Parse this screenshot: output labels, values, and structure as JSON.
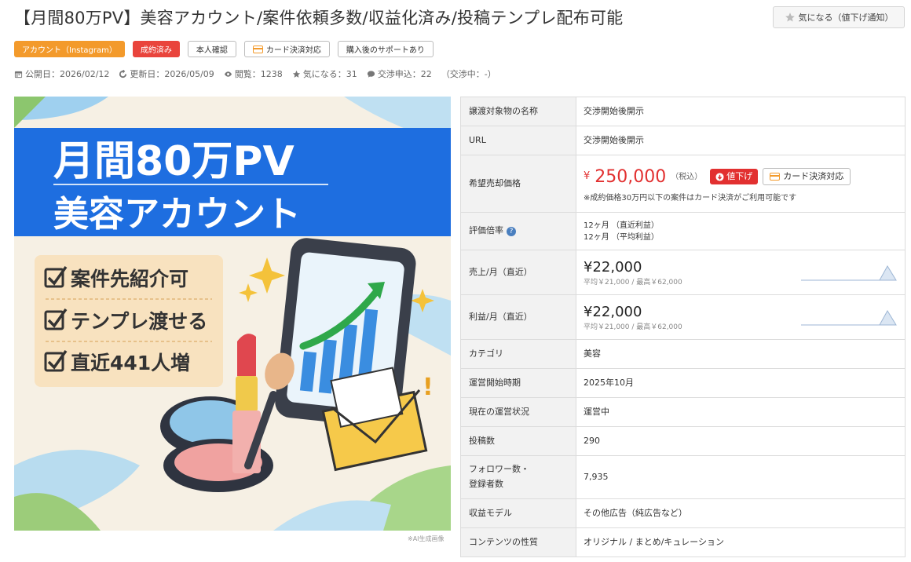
{
  "header": {
    "title": "【月間80万PV】美容アカウント/案件依頼多数/収益化済み/投稿テンプレ配布可能",
    "favorite_button": "気になる（値下げ通知）"
  },
  "tags": [
    {
      "label": "アカウント（Instagram）",
      "style": "orange"
    },
    {
      "label": "成約済み",
      "style": "red"
    },
    {
      "label": "本人確認",
      "style": "outline"
    },
    {
      "label": "カード決済対応",
      "style": "outline-card"
    },
    {
      "label": "購入後のサポートあり",
      "style": "outline"
    }
  ],
  "meta": {
    "published": "公開日：2026/02/12",
    "updated": "更新日：2026/05/09",
    "views": "閲覧：1238",
    "favorites": "気になる：31",
    "negotiations": "交渉申込：22",
    "negotiating": "（交渉中：-）"
  },
  "hero": {
    "headline_1": "月間80万PV",
    "headline_2": "美容アカウント",
    "check_1": "案件先紹介可",
    "check_2": "テンプレ渡せる",
    "check_3": "直近441人増",
    "ai_note": "※AI生成画像"
  },
  "details": {
    "name_label": "譲渡対象物の名称",
    "name_value": "交渉開始後開示",
    "url_label": "URL",
    "url_value": "交渉開始後開示",
    "price_label": "希望売却価格",
    "price_yen": "¥",
    "price_value": "250,000",
    "price_tax": "（税込）",
    "price_down_button": "値下げ",
    "card_button": "カード決済対応",
    "price_note": "※成約価格30万円以下の案件はカード決済がご利用可能です",
    "multiple_label": "評価倍率",
    "multiple_1": "12ヶ月 （直近利益）",
    "multiple_2": "12ヶ月 （平均利益）",
    "sales_label": "売上/月（直近）",
    "sales_value": "¥22,000",
    "sales_sub": "平均￥21,000 / 最高￥62,000",
    "profit_label": "利益/月（直近）",
    "profit_value": "¥22,000",
    "profit_sub": "平均￥21,000 / 最高￥62,000",
    "category_label": "カテゴリ",
    "category_value": "美容",
    "start_label": "運営開始時期",
    "start_value": "2025年10月",
    "status_label": "現在の運営状況",
    "status_value": "運営中",
    "posts_label": "投稿数",
    "posts_value": "290",
    "followers_label_1": "フォロワー数・",
    "followers_label_2": "登録者数",
    "followers_value": "7,935",
    "revenue_label": "収益モデル",
    "revenue_value": "その他広告（純広告など）",
    "content_label": "コンテンツの性質",
    "content_value": "オリジナル / まとめ/キュレーション"
  },
  "colors": {
    "accent_red": "#e23030",
    "tag_orange": "#f39a2b",
    "hero_blue": "#1e6ee0"
  }
}
